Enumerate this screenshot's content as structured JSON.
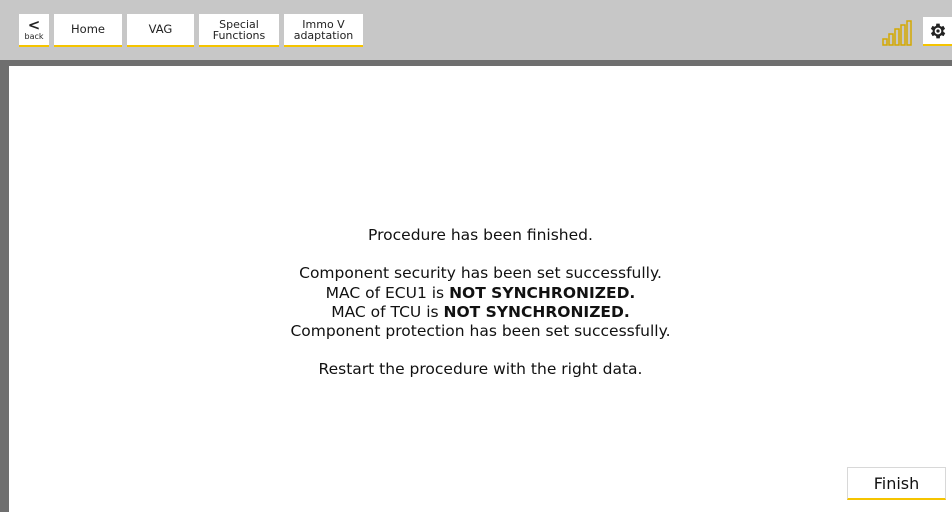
{
  "topbar": {
    "back_arrow": "<",
    "back_label": "back",
    "tabs": {
      "home": "Home",
      "vag": "VAG",
      "special_line1": "Special",
      "special_line2": "Functions",
      "immo_line1": "Immo V",
      "immo_line2": "adaptation"
    },
    "signal_icon": "signal-strength-icon",
    "settings_icon": "gear-icon"
  },
  "colors": {
    "accent": "#f5c400",
    "topbar_bg": "#c7c7c7",
    "frame_dark": "#6f6f6f"
  },
  "message": {
    "line1": "Procedure has been finished.",
    "line2": "Component security has been set successfully.",
    "line3_prefix": "MAC of ECU1 is ",
    "line3_bold": "NOT SYNCHRONIZED.",
    "line4_prefix": "MAC of TCU is ",
    "line4_bold": "NOT SYNCHRONIZED.",
    "line5": "Component protection has been set successfully.",
    "line6": "Restart the procedure with the right data."
  },
  "footer": {
    "finish_label": "Finish"
  }
}
